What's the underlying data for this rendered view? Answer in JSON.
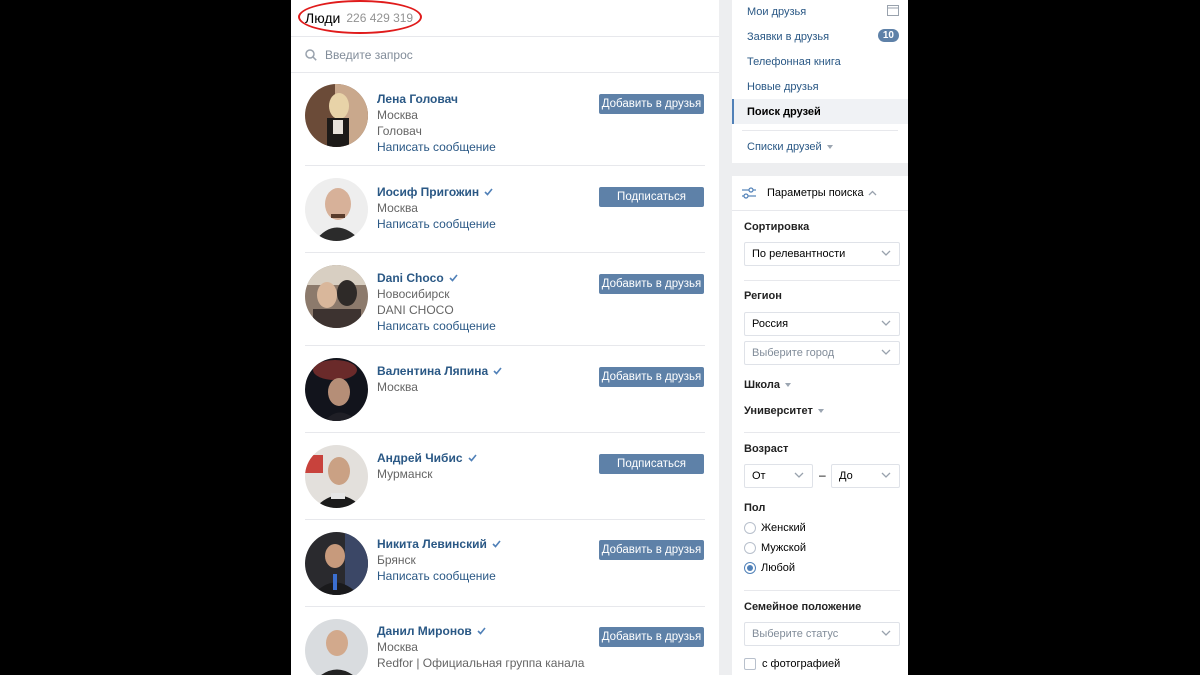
{
  "header": {
    "title": "Люди",
    "count": "226 429 319"
  },
  "search": {
    "placeholder": "Введите запрос"
  },
  "people": [
    {
      "name": "Лена Головач",
      "verified": false,
      "lines": [
        "Москва",
        "Головач"
      ],
      "message": "Написать сообщение",
      "action": "Добавить в друзья"
    },
    {
      "name": "Иосиф Пригожин",
      "verified": true,
      "lines": [
        "Москва"
      ],
      "message": "Написать сообщение",
      "action": "Подписаться"
    },
    {
      "name": "Dani Choco",
      "verified": true,
      "lines": [
        "Новосибирск",
        "DANI CHOCO"
      ],
      "message": "Написать сообщение",
      "action": "Добавить в друзья"
    },
    {
      "name": "Валентина Ляпина",
      "verified": true,
      "lines": [
        "Москва"
      ],
      "message": "",
      "action": "Добавить в друзья"
    },
    {
      "name": "Андрей Чибис",
      "verified": true,
      "lines": [
        "Мурманск"
      ],
      "message": "",
      "action": "Подписаться"
    },
    {
      "name": "Никита Левинский",
      "verified": true,
      "lines": [
        "Брянск"
      ],
      "message": "Написать сообщение",
      "action": "Добавить в друзья"
    },
    {
      "name": "Данил Миронов",
      "verified": true,
      "lines": [
        "Москва",
        "Redfor | Официальная группа канала"
      ],
      "message": "",
      "action": "Добавить в друзья"
    }
  ],
  "menu": {
    "my_friends": "Мои друзья",
    "requests": "Заявки в друзья",
    "requests_badge": "10",
    "phonebook": "Телефонная книга",
    "new_friends": "Новые друзья",
    "find_friends": "Поиск друзей",
    "lists": "Списки друзей"
  },
  "filters": {
    "title": "Параметры поиска",
    "sort_label": "Сортировка",
    "sort_value": "По релевантности",
    "region_label": "Регион",
    "country_value": "Россия",
    "city_placeholder": "Выберите город",
    "school": "Школа",
    "university": "Университет",
    "age_label": "Возраст",
    "age_from": "От",
    "age_dash": "–",
    "age_to": "До",
    "sex_label": "Пол",
    "sex_options": [
      "Женский",
      "Мужской",
      "Любой"
    ],
    "sex_selected": "Любой",
    "marital_label": "Семейное положение",
    "marital_placeholder": "Выберите статус",
    "with_photo": "с фотографией"
  },
  "colors": {
    "link": "#2a5885",
    "button": "#5e81a8",
    "annotation": "#e01b1b"
  }
}
